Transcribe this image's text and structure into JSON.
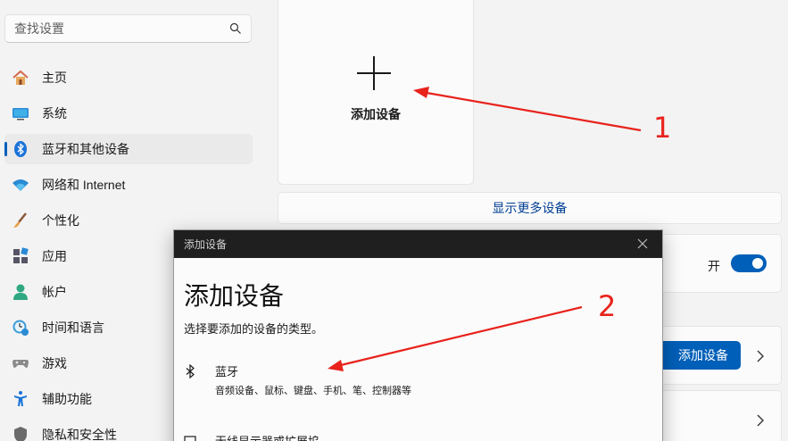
{
  "search": {
    "placeholder": "查找设置"
  },
  "sidebar": {
    "items": [
      {
        "label": "主页",
        "icon": "home-icon"
      },
      {
        "label": "系统",
        "icon": "system-icon"
      },
      {
        "label": "蓝牙和其他设备",
        "icon": "bluetooth-icon",
        "active": true
      },
      {
        "label": "网络和 Internet",
        "icon": "wifi-icon"
      },
      {
        "label": "个性化",
        "icon": "brush-icon"
      },
      {
        "label": "应用",
        "icon": "apps-icon"
      },
      {
        "label": "帐户",
        "icon": "account-icon"
      },
      {
        "label": "时间和语言",
        "icon": "time-language-icon"
      },
      {
        "label": "游戏",
        "icon": "gamepad-icon"
      },
      {
        "label": "辅助功能",
        "icon": "accessibility-icon"
      },
      {
        "label": "隐私和安全性",
        "icon": "privacy-icon"
      }
    ]
  },
  "main": {
    "add_card_label": "添加设备",
    "show_more": "显示更多设备",
    "toggle_label": "开",
    "add_button": "添加设备"
  },
  "dialog": {
    "title": "添加设备",
    "heading": "添加设备",
    "subtitle": "选择要添加的设备的类型。",
    "options": [
      {
        "title": "蓝牙",
        "desc": "音频设备、鼠标、键盘、手机、笔、控制器等"
      },
      {
        "title": "无线显示器或扩展坞",
        "desc": ""
      }
    ]
  },
  "annotations": {
    "marker1": "1",
    "marker2": "2",
    "color": "#e8221c"
  },
  "colors": {
    "accent": "#005fb8",
    "link": "#003e92"
  }
}
